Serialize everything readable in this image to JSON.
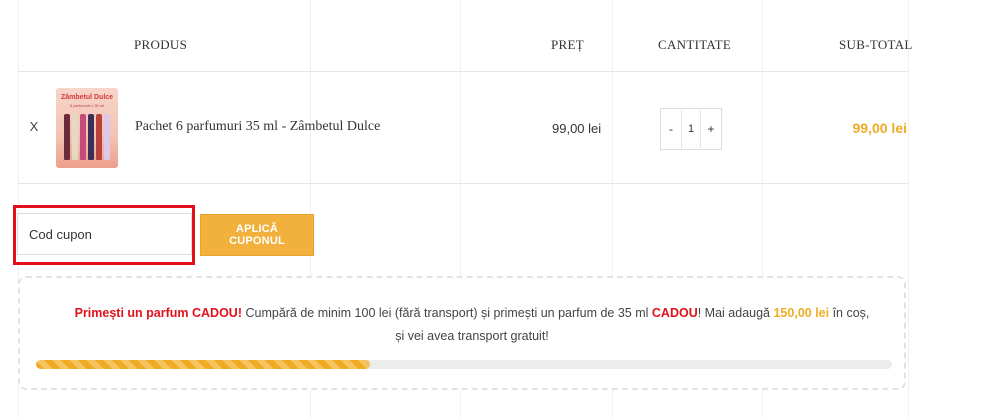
{
  "cart": {
    "headers": {
      "product": "PRODUS",
      "price": "PREȚ",
      "quantity": "CANTITATE",
      "subtotal": "SUB-TOTAL"
    },
    "items": [
      {
        "remove": "X",
        "thumb_title": "Zâmbetul Dulce",
        "thumb_subtitle": "6 parfumuri x 35 ml",
        "name": "Pachet 6 parfumuri 35 ml - Zâmbetul Dulce",
        "price": "99,00 lei",
        "qty_minus": "-",
        "qty_value": "1",
        "qty_plus": "+",
        "subtotal": "99,00 lei"
      }
    ]
  },
  "coupon": {
    "placeholder": "Cod cupon",
    "button_label": "APLICĂ CUPONUL"
  },
  "notice": {
    "gift_title": "Primești un parfum CADOU!",
    "text_1": " Cumpără de minim 100 lei (fără transport) și primești un parfum de 35 ml ",
    "gift_word": "CADOU",
    "text_2": "! Mai adaugă ",
    "amount": "150,00 lei",
    "text_3": " în coș, și vei avea transport gratuit!",
    "progress_fraction": 0.39
  },
  "colors": {
    "accent": "#f0ab25",
    "highlight_red": "#e0111a",
    "button_bg": "#f2b03c"
  },
  "icons": {
    "remove": "close-x-icon"
  }
}
